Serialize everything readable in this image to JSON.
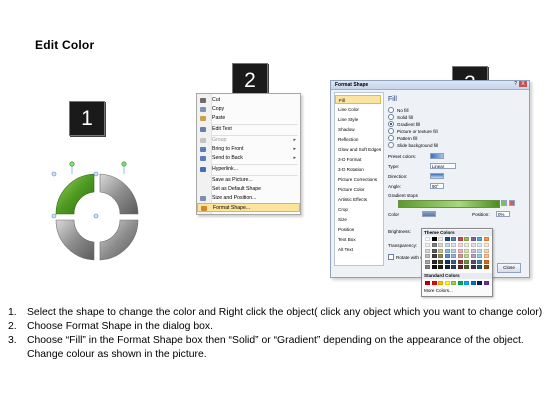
{
  "title": "Edit Color",
  "badges": [
    "1",
    "2",
    "3"
  ],
  "context_menu": {
    "items": [
      {
        "label": "Cut",
        "icon": "scissors-icon",
        "color": "#6b6b6b"
      },
      {
        "label": "Copy",
        "icon": "copy-icon",
        "color": "#7e93b4"
      },
      {
        "label": "Paste",
        "icon": "paste-icon",
        "color": "#c9a24a"
      },
      {
        "label": "Edit Text",
        "icon": "edit-text-icon",
        "color": "#6a7fa8"
      },
      {
        "label": "Group",
        "icon": "group-icon",
        "color": "#b0b0b0",
        "disabled": true,
        "submenu": true
      },
      {
        "label": "Bring to Front",
        "icon": "bring-front-icon",
        "color": "#5a7db5",
        "submenu": true
      },
      {
        "label": "Send to Back",
        "icon": "send-back-icon",
        "color": "#5a7db5",
        "submenu": true
      },
      {
        "label": "Hyperlink...",
        "icon": "hyperlink-icon",
        "color": "#3f6fbf"
      },
      {
        "label": "Save as Picture...",
        "icon": "",
        "color": ""
      },
      {
        "label": "Set as Default Shape",
        "icon": "",
        "color": ""
      },
      {
        "label": "Size and Position...",
        "icon": "size-position-icon",
        "color": "#7b8fb0"
      },
      {
        "label": "Format Shape...",
        "icon": "format-shape-icon",
        "color": "#d08a2a",
        "highlighted": true
      }
    ]
  },
  "dialog": {
    "title": "Format Shape",
    "help": "?",
    "close_glyph": "X",
    "categories": [
      "Fill",
      "Line Color",
      "Line Style",
      "Shadow",
      "Reflection",
      "Glow and Soft Edges",
      "3-D Format",
      "3-D Rotation",
      "Picture Corrections",
      "Picture Color",
      "Artistic Effects",
      "Crop",
      "Size",
      "Position",
      "Text Box",
      "Alt Text"
    ],
    "heading": "Fill",
    "fill_options": [
      {
        "label": "No fill",
        "checked": false
      },
      {
        "label": "Solid fill",
        "checked": false
      },
      {
        "label": "Gradient fill",
        "checked": true
      },
      {
        "label": "Picture or texture fill",
        "checked": false
      },
      {
        "label": "Pattern fill",
        "checked": false
      },
      {
        "label": "Slide background fill",
        "checked": false
      }
    ],
    "preset_colors_label": "Preset colors:",
    "type_label": "Type:",
    "type_value": "Linear",
    "direction_label": "Direction:",
    "angle_label": "Angle:",
    "angle_value": "90°",
    "gradient_stops_label": "Gradient stops",
    "color_label": "Color",
    "position_label": "Position:",
    "position_value": "0%",
    "brightness_label": "Brightness:",
    "transparency_label": "Transparency:",
    "rotate_label": "Rotate with shape",
    "close_label": "Close"
  },
  "palette": {
    "theme_heading": "Theme Colors",
    "standard_heading": "Standard Colors",
    "more_label": "More Colors...",
    "theme_top": [
      "#ffffff",
      "#000000",
      "#eeece1",
      "#1f497d",
      "#4f81bd",
      "#c0504d",
      "#9bbb59",
      "#8064a2",
      "#4bacc6",
      "#f79646"
    ],
    "theme_shades": [
      [
        "#f2f2f2",
        "#7f7f7f",
        "#ddd9c3",
        "#c6d9f0",
        "#dbe5f1",
        "#f2dcdb",
        "#ebf1dd",
        "#e5e0ec",
        "#dbeef3",
        "#fdeada"
      ],
      [
        "#d8d8d8",
        "#595959",
        "#c4bd97",
        "#8db3e2",
        "#b8cce4",
        "#e5b9b7",
        "#d7e3bc",
        "#ccc1d9",
        "#b7dde8",
        "#fbd5b5"
      ],
      [
        "#bfbfbf",
        "#3f3f3f",
        "#938953",
        "#548dd4",
        "#95b3d7",
        "#d99694",
        "#c3d69b",
        "#b2a2c7",
        "#92cddc",
        "#fac08f"
      ],
      [
        "#a5a5a5",
        "#262626",
        "#494429",
        "#17365d",
        "#366092",
        "#953734",
        "#76923c",
        "#5f497a",
        "#31859b",
        "#e36c09"
      ],
      [
        "#7f7f7f",
        "#0c0c0c",
        "#1d1b10",
        "#0f243e",
        "#244061",
        "#632423",
        "#4f6128",
        "#3f3151",
        "#205867",
        "#974806"
      ]
    ],
    "standard": [
      "#c00000",
      "#ff0000",
      "#ffc000",
      "#ffff00",
      "#92d050",
      "#00b050",
      "#00b0f0",
      "#0070c0",
      "#002060",
      "#7030a0"
    ]
  },
  "shape_colors": {
    "green": "#5aa52a",
    "gray": "#9a9a9a"
  },
  "instructions": [
    {
      "num": "1.",
      "text": "Select the shape to change the color and Right click the object( click any object which you want to change color)"
    },
    {
      "num": "2.",
      "text": "Choose Format Shape in the dialog box."
    },
    {
      "num": "3.",
      "text": "Choose “Fill” in the Format Shape box then “Solid” or “Gradient” depending on the appearance of the object. Change colour as shown in the picture."
    }
  ]
}
